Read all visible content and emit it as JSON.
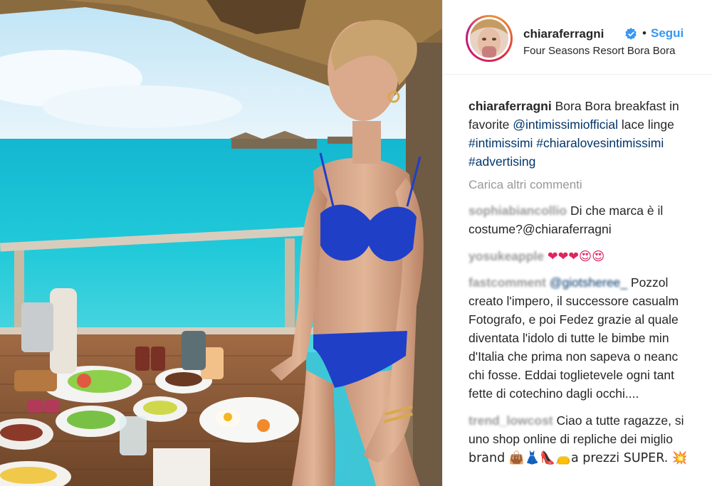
{
  "post": {
    "username": "chiaraferragni",
    "follow_label": "Segui",
    "dot": "•",
    "location": "Four Seasons Resort Bora Bora"
  },
  "caption": {
    "username": "chiaraferragni",
    "line1": "Bora Bora breakfast in",
    "line2_prefix": "favorite ",
    "mention": "@intimissimiofficial",
    "line2_suffix": " lace linge",
    "hashtags_line3": "#intimissimi #chiaralovesintimissimi",
    "hashtags_line4": "#advertising"
  },
  "load_more_label": "Carica altri commenti",
  "comments": [
    {
      "username": "sophiabiancollio",
      "lines": [
        "Di che marca è il",
        "costume?@chiaraferragni"
      ]
    },
    {
      "username": "yosukeapple",
      "lines": [
        "❤❤❤😍😍"
      ]
    },
    {
      "username": "fastcomment",
      "mention": "@giotsheree_",
      "lines": [
        " Pozzol",
        "creato l'impero, il successore casualm",
        "Fotografo, e poi Fedez grazie al quale",
        "diventata l'idolo di tutte le bimbe min",
        "d'Italia che prima non sapeva o neanc",
        "chi fosse. Eddai toglietevele ogni tant",
        "fette di cotechino dagli occhi...."
      ]
    },
    {
      "username": "trend_lowcost",
      "lines": [
        " Ciao a tutte ragazze, si",
        "uno shop online di repliche dei miglio",
        "brand 👜👗👠👝a prezzi SUPER. 💥"
      ]
    }
  ],
  "icons": {
    "verified": "verified-badge-icon",
    "avatar": "profile-avatar"
  },
  "colors": {
    "link_blue": "#3897f0",
    "mention_blue": "#003569",
    "verified_blue": "#3897f0",
    "muted": "#999999"
  }
}
